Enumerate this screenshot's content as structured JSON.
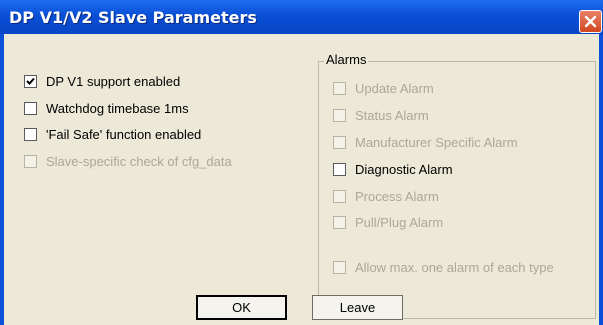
{
  "window": {
    "title": "DP V1/V2 Slave Parameters",
    "close_icon": "close-icon"
  },
  "left_options": [
    {
      "label": "DP V1 support enabled",
      "checked": true,
      "enabled": true
    },
    {
      "label": "Watchdog timebase 1ms",
      "checked": false,
      "enabled": true
    },
    {
      "label": "'Fail Safe' function enabled",
      "checked": false,
      "enabled": true
    },
    {
      "label": "Slave-specific check of cfg_data",
      "checked": false,
      "enabled": false
    }
  ],
  "alarms": {
    "caption": "Alarms",
    "items": [
      {
        "label": "Update Alarm",
        "checked": false,
        "enabled": false
      },
      {
        "label": "Status Alarm",
        "checked": false,
        "enabled": false
      },
      {
        "label": "Manufacturer Specific Alarm",
        "checked": false,
        "enabled": false
      },
      {
        "label": "Diagnostic Alarm",
        "checked": false,
        "enabled": true
      },
      {
        "label": "Process Alarm",
        "checked": false,
        "enabled": false
      },
      {
        "label": "Pull/Plug Alarm",
        "checked": false,
        "enabled": false
      }
    ],
    "allow_one": {
      "label": "Allow max. one alarm of each type",
      "checked": false,
      "enabled": false
    }
  },
  "buttons": {
    "ok_label": "OK",
    "leave_label": "Leave"
  },
  "colors": {
    "title_bar": "#0a50d8",
    "dialog_face": "#ece9d8",
    "disabled_text": "#aca899",
    "close_button": "#d2461f"
  }
}
